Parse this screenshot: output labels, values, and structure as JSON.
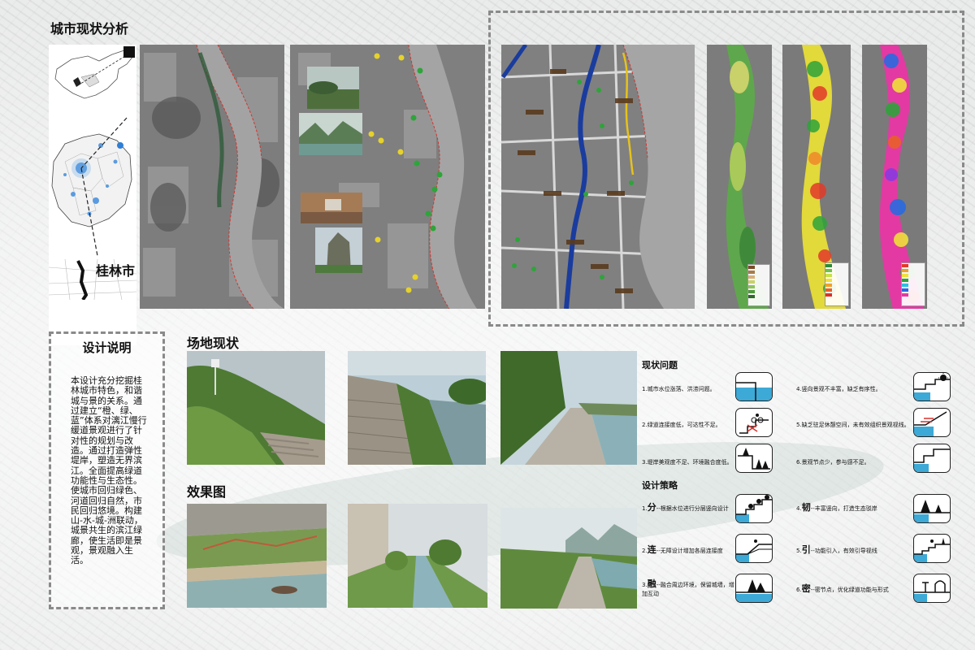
{
  "header": {
    "title": "城市现状分析"
  },
  "location": {
    "city_label": "桂林市"
  },
  "poi_photos": {},
  "colors": {
    "dashed_border": "#8a8a8a",
    "water_blue": "#3da9d6",
    "road_blue": "#1a3c9e",
    "road_yellow": "#e6c21c",
    "green_marker": "#2ea43a",
    "red_boundary": "#d8322c"
  },
  "design_notes": {
    "heading": "设计说明",
    "body": "本设计充分挖掘桂林城市特色，和谐城与景的关系。通过建立“橙、绿、蓝”体系对漓江慢行缓道景观进行了针对性的规划与改造。通过打造弹性堤岸，塑造无界滨江。全面提高绿道功能性与生态性。使城市回归绿色、河道回归自然，市民回归悠境。构建山-水-城-洲联动，城景共生的滨江绿廊，使生活即是景观，景观融入生活。"
  },
  "site_status": {
    "heading": "场地现状"
  },
  "renderings": {
    "heading": "效果图"
  },
  "issues": {
    "heading": "现状问题",
    "items": [
      {
        "text": "1.城市水位涨落、洪涝问题。",
        "icon": "water-level-icon"
      },
      {
        "text": "2.绿道连接度低，可达性不足。",
        "icon": "cyclist-stair-icon"
      },
      {
        "text": "3.堤岸美观度不足、环境融合度低。",
        "icon": "tree-embankment-icon"
      },
      {
        "text": "4.竖向景观不丰富，缺乏有序性。",
        "icon": "sun-terrace-icon"
      },
      {
        "text": "5.缺乏驻足休憩空间，未有效组织景观视线。",
        "icon": "slope-sight-icon"
      },
      {
        "text": "6.景观节点少，参与感不足。",
        "icon": "step-node-icon"
      }
    ]
  },
  "strategies": {
    "heading": "设计策略",
    "items": [
      {
        "num": "1.",
        "key": "分",
        "text": "--根据水位进行分层竖向设计",
        "icon": "layered-slope-icon"
      },
      {
        "num": "2.",
        "key": "连",
        "text": "--无障设计增加各层连接度",
        "icon": "ramp-connect-icon"
      },
      {
        "num": "3.",
        "key": "融",
        "text": "--融合周边环境，保留城墙，增加互动",
        "icon": "blend-trees-icon"
      },
      {
        "num": "4.",
        "key": "韧",
        "text": "--丰富竖向，打造生态驳岸",
        "icon": "resilient-bank-icon"
      },
      {
        "num": "5.",
        "key": "引",
        "text": "--功能引入，有效引导视线",
        "icon": "guide-steps-icon"
      },
      {
        "num": "6.",
        "key": "密",
        "text": "--密节点，优化绿道功能与形式",
        "icon": "dense-node-icon"
      }
    ]
  }
}
